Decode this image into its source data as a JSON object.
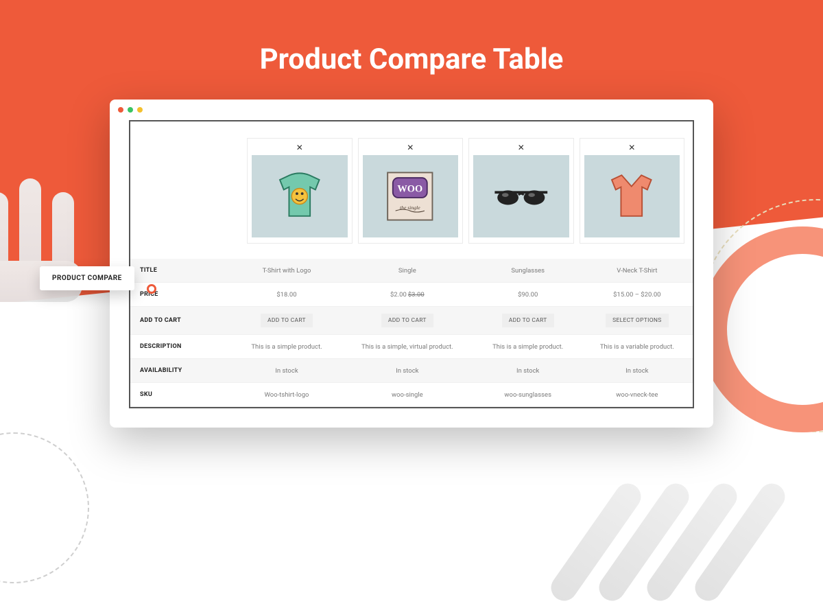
{
  "page": {
    "title": "Product Compare Table",
    "tag_label": "PRODUCT COMPARE"
  },
  "rows": {
    "title": "TITLE",
    "price": "PRICE",
    "add": "ADD TO CART",
    "desc": "DESCRIPTION",
    "avail": "AVAILABILITY",
    "sku": "SKU"
  },
  "products": [
    {
      "title": "T-Shirt with Logo",
      "price": "$18.00",
      "price_strike": "",
      "cta": "ADD TO CART",
      "desc": "This is a simple product.",
      "avail": "In stock",
      "sku": "Woo-tshirt-logo"
    },
    {
      "title": "Single",
      "price": "$2.00",
      "price_strike": "$3.00",
      "cta": "ADD TO CART",
      "desc": "This is a simple, virtual product.",
      "avail": "In stock",
      "sku": "woo-single"
    },
    {
      "title": "Sunglasses",
      "price": "$90.00",
      "price_strike": "",
      "cta": "ADD TO CART",
      "desc": "This is a simple product.",
      "avail": "In stock",
      "sku": "woo-sunglasses"
    },
    {
      "title": "V-Neck T-Shirt",
      "price": "$15.00 – $20.00",
      "price_strike": "",
      "cta": "SELECT OPTIONS",
      "desc": "This is a variable product.",
      "avail": "In stock",
      "sku": "woo-vneck-tee"
    }
  ]
}
